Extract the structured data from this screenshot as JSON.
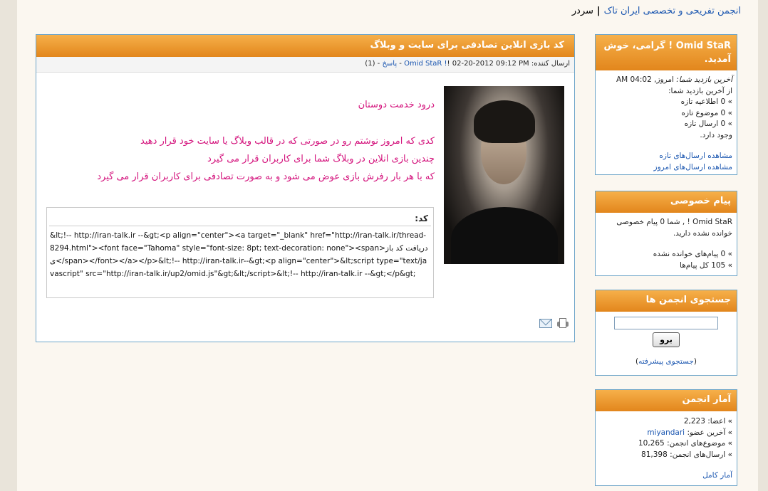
{
  "breadcrumb": {
    "forum": "انجمن تفریحی و تخصصی ایران تاک",
    "current": "سردر"
  },
  "post": {
    "title": "کد بازی انلاین تصادفی برای سایت و وبلاگ",
    "meta_prefix": "ارسال کننده: ",
    "author": "Omid StaR !",
    "date": "! 02-20-2012 09:12 PM - ",
    "reply_link": "پاسخ",
    "reply_count": " - (1)",
    "body_greeting": "درود خدمت دوستان",
    "body_line1": "کدی که امروز نوشتم رو در صورتی که در قالب وبلاگ یا سایت خود قرار دهید",
    "body_line2": "چندین بازی انلاین در وبلاگ شما برای کاربران قرار می گیرد",
    "body_line3": "که با هر بار رفرش بازی عوض می شود و به صورت تصادفی برای کاربران قرار می گیرد",
    "code_label": "کد:",
    "code_text": "&lt;!-- http://iran-talk.ir --&gt;<p align=\"center\"><a target=\"_blank\" href=\"http://iran-talk.ir/thread-8294.html\"><font face=\"Tahoma\" style=\"font-size: 8pt; text-decoration: none\"><span>دریافت کد بازی</span></font></a></p>&lt;!-- http://iran-talk.ir--&gt;<p align=\"center\">&lt;script type=\"text/javascript\" src=\"http://iran-talk.ir/up2/omid.js\"&gt;&lt;/script>&lt;!-- http://iran-talk.ir --&gt;</p&gt;",
    "email_icon": "email-icon",
    "print_icon": "print-icon"
  },
  "welcome": {
    "title": "Omid StaR ! گرامی، خوش آمدید.",
    "last_visit_label": "آخرین بازدید شما:",
    "last_visit_value": " امروز, 04:02 AM",
    "since_last": "از آخرین بازدید شما:",
    "new_announcements": "» 0 اطلاعیه تازه",
    "new_threads": "» 0 موضوع تازه",
    "new_posts": "» 0 ارسال تازه",
    "exists": "وجود دارد.",
    "view_new_posts": "مشاهده ارسال‌های تازه",
    "view_todays_posts": "مشاهده ارسال‌های امروز"
  },
  "pm": {
    "title": "پیام خصوصی",
    "line1": "Omid StaR ! , شما 0 پیام خصوصی خوانده نشده دارید.",
    "unread": "» 0 پیام‌های خوانده نشده",
    "total": "» 105 کل پیام‌ها"
  },
  "search": {
    "title": "جستجوی انجمن ها",
    "button": "برو",
    "advanced_open": "(",
    "advanced": "جستجوی پیشرفته",
    "advanced_close": ")"
  },
  "stats": {
    "title": "آمار انجمن",
    "members": "» اعضا: 2,223",
    "newest_label": "» آخرین عضو: ",
    "newest_member": "miyandari",
    "threads": "» موضوع‌های انجمن: 10,265",
    "posts": "» ارسال‌های انجمن: 81,398",
    "full_stats": "آمار کامل"
  }
}
